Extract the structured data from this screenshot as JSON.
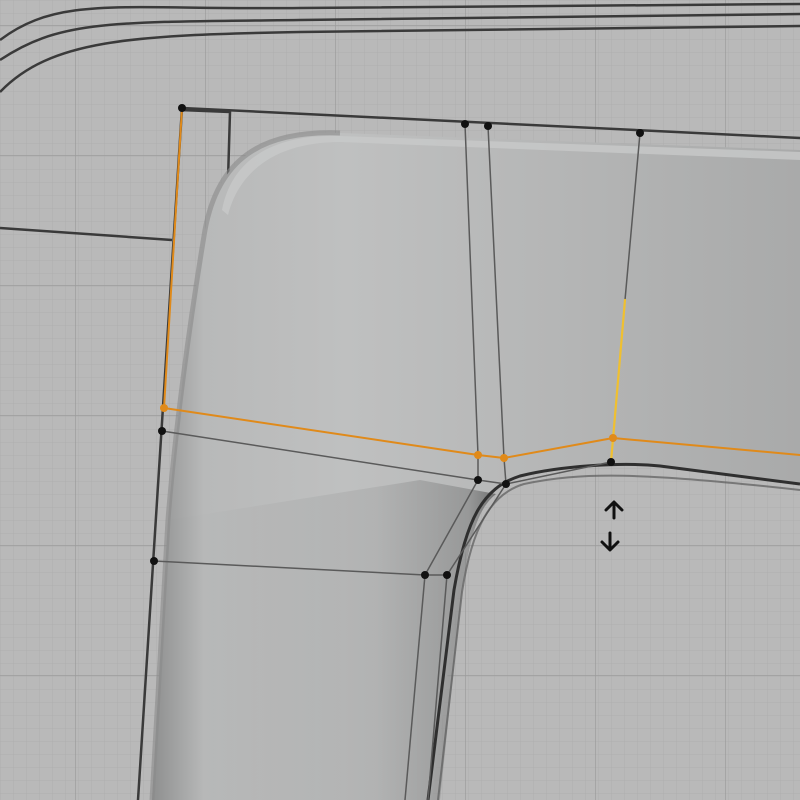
{
  "viewport": {
    "background_color": "#b9b9b9",
    "grid_minor_color": "#aeaeae",
    "grid_major_color": "#9c9c9c"
  },
  "mesh": {
    "surface_light": "#bfc0c0",
    "surface_mid": "#a9aaaa",
    "surface_dark": "#8a8b8b",
    "rim_color": "#2f2f2f"
  },
  "cage": {
    "wire_color": "#3a3a3a",
    "edge_color": "#5a5a5a",
    "vertex_color": "#111111",
    "selected_color": "#e08a1a",
    "active_edge_color": "#f0c030"
  },
  "cursor": {
    "icon": "vertical-resize-icon",
    "color": "#111111"
  }
}
